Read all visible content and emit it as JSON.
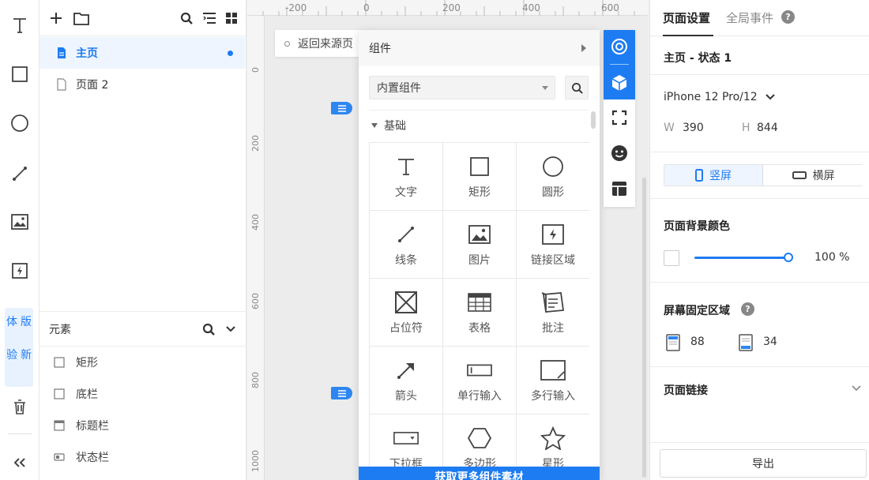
{
  "pages_panel": {
    "pages": [
      {
        "label": "主页",
        "active": true,
        "modified": true
      },
      {
        "label": "页面 2",
        "active": false,
        "modified": false
      }
    ]
  },
  "sidebar": {
    "experience_badge": [
      "体",
      "版",
      "验",
      "新"
    ]
  },
  "elements": {
    "header": "元素",
    "items": [
      {
        "label": "矩形",
        "icon": "checkbox-square-icon"
      },
      {
        "label": "底栏",
        "icon": "checkbox-square-icon"
      },
      {
        "label": "标题栏",
        "icon": "title-bar-icon"
      },
      {
        "label": "状态栏",
        "icon": "status-bar-icon"
      }
    ]
  },
  "canvas": {
    "ruler_top": [
      "-200",
      "0",
      "200",
      "400",
      "600"
    ],
    "ruler_left": [
      "0",
      "200",
      "400",
      "600",
      "800",
      "1000"
    ],
    "back_chip": "返回来源页"
  },
  "components": {
    "header": "组件",
    "library_select": "内置组件",
    "category": "基础",
    "items": [
      {
        "label": "文字",
        "icon": "text-icon"
      },
      {
        "label": "矩形",
        "icon": "rectangle-icon"
      },
      {
        "label": "圆形",
        "icon": "circle-icon"
      },
      {
        "label": "线条",
        "icon": "line-icon"
      },
      {
        "label": "图片",
        "icon": "image-icon"
      },
      {
        "label": "链接区域",
        "icon": "hotspot-icon"
      },
      {
        "label": "占位符",
        "icon": "placeholder-icon"
      },
      {
        "label": "表格",
        "icon": "table-icon"
      },
      {
        "label": "批注",
        "icon": "note-icon"
      },
      {
        "label": "箭头",
        "icon": "arrow-icon"
      },
      {
        "label": "单行输入",
        "icon": "input-icon"
      },
      {
        "label": "多行输入",
        "icon": "textarea-icon"
      },
      {
        "label": "下拉框",
        "icon": "dropdown-icon"
      },
      {
        "label": "多边形",
        "icon": "polygon-icon"
      },
      {
        "label": "星形",
        "icon": "star-icon"
      }
    ],
    "more_button": "获取更多组件素材"
  },
  "settings": {
    "tabs": [
      "页面设置",
      "全局事件"
    ],
    "page_state": "主页 - 状态 1",
    "device": "iPhone 12 Pro/12",
    "width_label": "W",
    "width": "390",
    "height_label": "H",
    "height": "844",
    "orientation": {
      "portrait": "竖屏",
      "landscape": "横屏",
      "selected": "portrait"
    },
    "background_title": "页面背景颜色",
    "background_color": "#ffffff",
    "opacity": "100 %",
    "opacity_value": 100,
    "fixed_area_title": "屏幕固定区域",
    "fixed_top": "88",
    "fixed_bottom": "34",
    "page_links_title": "页面链接",
    "export_button": "导出"
  },
  "colors": {
    "accent": "#1e7cf2",
    "panel_bg": "#ffffff",
    "canvas_bg": "#ececec"
  }
}
